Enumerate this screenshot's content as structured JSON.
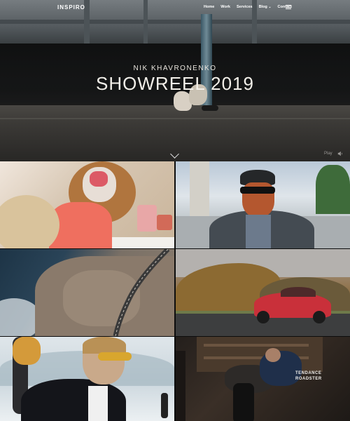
{
  "nav": {
    "logo": "INSPIRO",
    "items": [
      "Home",
      "Work",
      "Services",
      "Blog",
      "Contact"
    ],
    "blog_caret": "⌄"
  },
  "hero": {
    "subtitle": "NIK KHAVRONENKO",
    "title": "SHOWREEL 2019",
    "play_label": "Play"
  },
  "tiles": [
    {
      "caption_line1": "",
      "caption_line2": ""
    },
    {
      "caption_line1": "",
      "caption_line2": ""
    },
    {
      "caption_line1": "",
      "caption_line2": ""
    },
    {
      "caption_line1": "",
      "caption_line2": ""
    },
    {
      "caption_line1": "",
      "caption_line2": ""
    },
    {
      "caption_line1": "TENDANCE",
      "caption_line2": "ROADSTER"
    }
  ],
  "colors": {
    "nav_text": "#ffffff",
    "hero_title": "#f2efe9",
    "car": "#c9303a"
  },
  "icons": [
    "menu-icon",
    "chevron-down-icon",
    "volume-icon"
  ]
}
